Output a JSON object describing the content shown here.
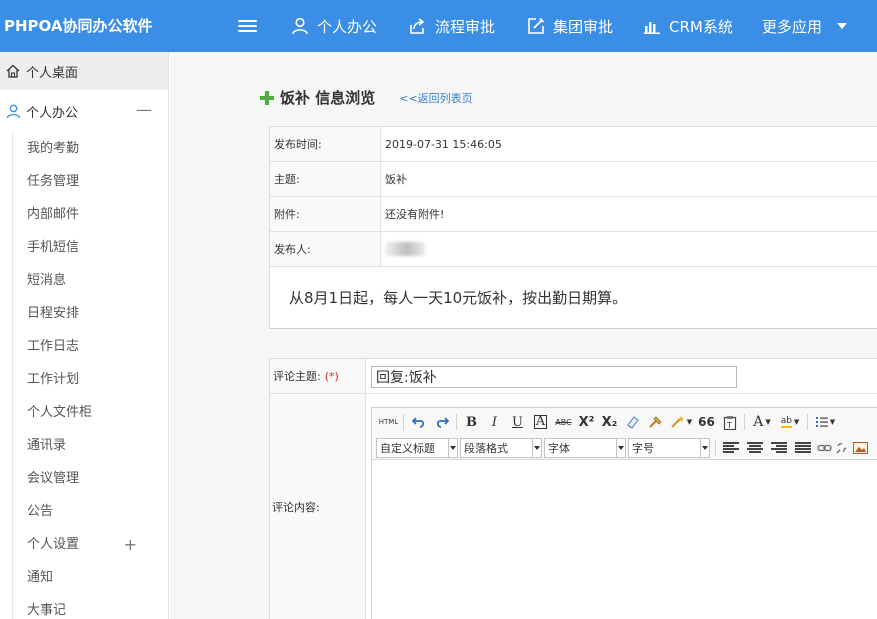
{
  "app": {
    "brand": "PHPOA协同办公软件"
  },
  "topnav": {
    "items": [
      {
        "label": "个人办公",
        "icon": "user-icon"
      },
      {
        "label": "流程审批",
        "icon": "share-icon"
      },
      {
        "label": "集团审批",
        "icon": "edit-icon"
      },
      {
        "label": "CRM系统",
        "icon": "bar-chart-icon"
      },
      {
        "label": "更多应用",
        "icon": "chevron-down-icon"
      }
    ]
  },
  "sidebar": {
    "desk_label": "个人桌面",
    "group_label": "个人办公",
    "group_toggle": "—",
    "settings_toggle": "+",
    "items": [
      "我的考勤",
      "任务管理",
      "内部邮件",
      "手机短信",
      "短消息",
      "日程安排",
      "工作日志",
      "工作计划",
      "个人文件柜",
      "通讯录",
      "会议管理",
      "公告",
      "个人设置",
      "通知",
      "大事记"
    ]
  },
  "page": {
    "title": "饭补  信息浏览",
    "back_link": "<<返回列表页"
  },
  "info": {
    "publish_time_label": "发布时间:",
    "publish_time": "2019-07-31 15:46:05",
    "subject_label": "主题:",
    "subject": "饭补",
    "attachment_label": "附件:",
    "attachment": "还没有附件!",
    "publisher_label": "发布人:",
    "content": "从8月1日起，每人一天10元饭补，按出勤日期算。"
  },
  "reply": {
    "subject_label": "评论主题:",
    "required_mark": "(*)",
    "subject_value": "回复:饭补",
    "content_label": "评论内容:"
  },
  "editor": {
    "html_label": "HTML",
    "bold": "B",
    "italic": "I",
    "underline": "U",
    "border_a": "A",
    "strike": "ABC",
    "superscript": "X²",
    "subscript": "X₂",
    "quote": "66",
    "font_color": "A",
    "highlight": "ab",
    "selects": {
      "custom_title": "自定义标题",
      "paragraph": "段落格式",
      "font": "字体",
      "size": "字号"
    }
  },
  "colors": {
    "topbar": "#3a8ee6",
    "plus": "#4caf3c",
    "link": "#3a7fd0",
    "required": "#e02020"
  }
}
